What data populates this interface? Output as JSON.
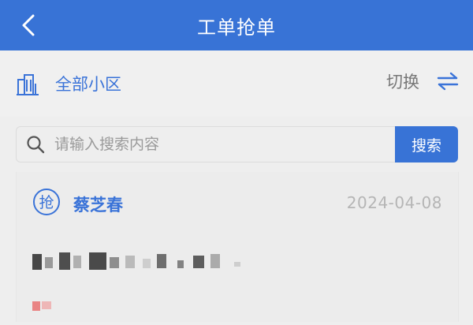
{
  "header": {
    "title": "工单抢单",
    "back_icon": "chevron-left-icon"
  },
  "community": {
    "name": "全部小区",
    "switch_label": "切换",
    "building_icon": "building-icon",
    "switch_icon": "swap-arrows-icon"
  },
  "search": {
    "placeholder": "请输入搜索内容",
    "value": "",
    "button_label": "搜索",
    "icon": "search-icon"
  },
  "order": {
    "badge_char": "抢",
    "assignee": "蔡芝春",
    "date": "2024-04-08"
  },
  "colors": {
    "primary": "#3873d6",
    "link_blue": "#3a73d8",
    "muted_text": "#b5b5b5"
  }
}
